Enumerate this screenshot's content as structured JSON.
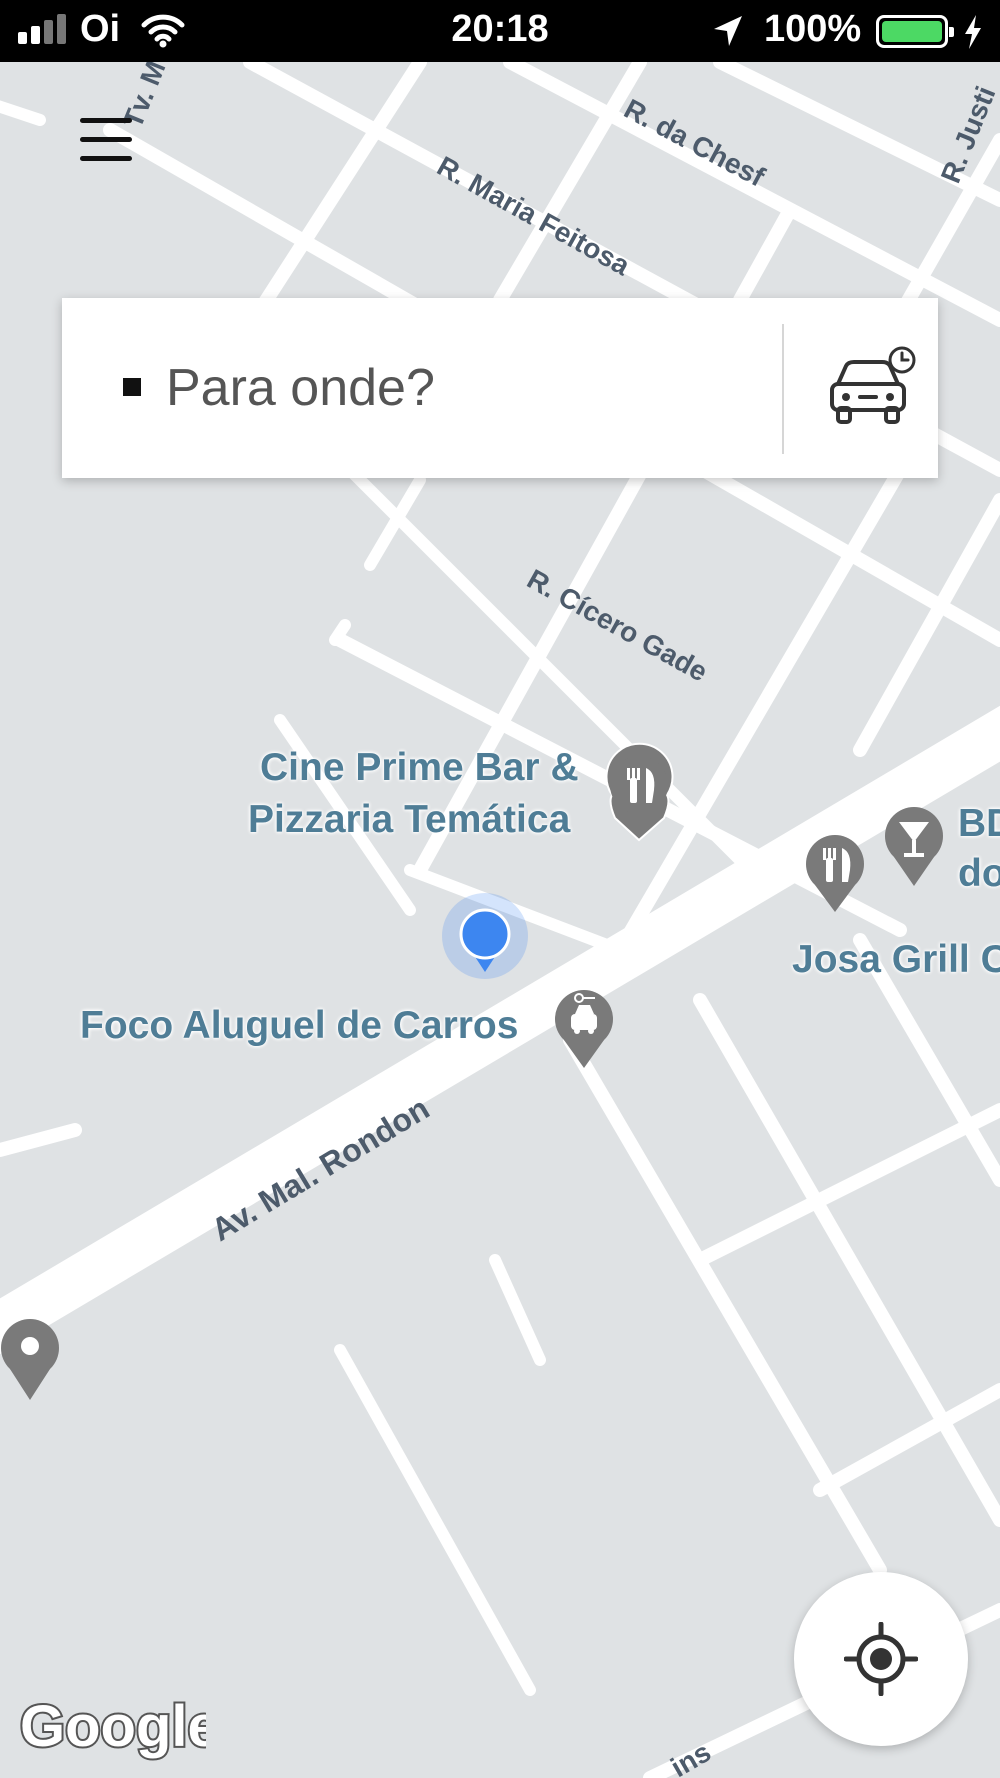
{
  "status_bar": {
    "carrier": "Oi",
    "time": "20:18",
    "battery_percent": "100%"
  },
  "search": {
    "placeholder": "Para onde?",
    "schedule_icon": "car-clock-icon"
  },
  "map": {
    "streets": [
      "Tv. M",
      "R. da Chesf",
      "R. Maria Feitosa",
      "R. Justi",
      "R. Cícero Gade",
      "Av. Mal. Rondon",
      "ins"
    ],
    "places": [
      {
        "line1": "Cine Prime Bar &",
        "line2": "Pizzaria Temática",
        "icon": "restaurant-icon"
      },
      {
        "line1": "Foco Aluguel de Carros",
        "icon": "car-rental-icon"
      },
      {
        "line1": "BD",
        "line2": "do",
        "icon": "bar-icon"
      },
      {
        "line1": "Josa Grill C",
        "icon": "restaurant-icon"
      }
    ],
    "attribution": "Google"
  },
  "colors": {
    "map_background": "#dfe2e4",
    "road": "#ffffff",
    "poi_text": "#4f7d96",
    "user_location": "#3d86f0",
    "battery": "#4cd964"
  }
}
